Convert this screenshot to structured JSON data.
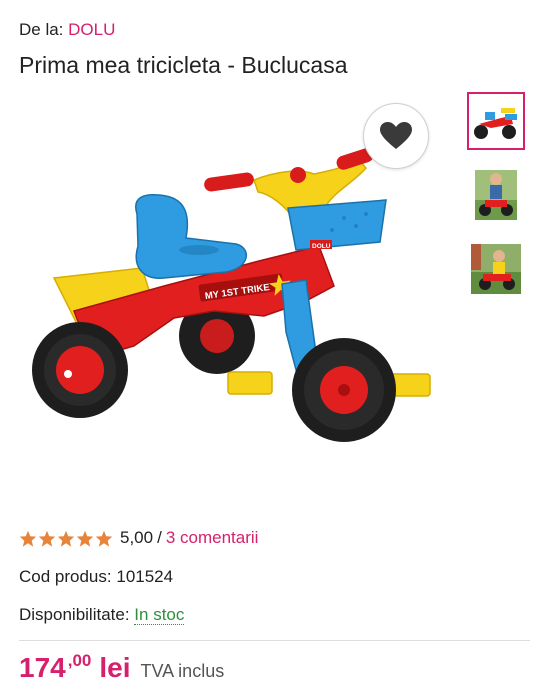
{
  "seller": {
    "prefix": "De la:",
    "name": "DOLU"
  },
  "product": {
    "title": "Prima mea tricicleta - Buclucasa",
    "decal_text": "MY 1ST TRIKE",
    "brand_badge": "DOLU"
  },
  "favorite": {
    "icon": "heart-icon"
  },
  "thumbnails": [
    {
      "name": "thumb-tricycle",
      "active": true
    },
    {
      "name": "thumb-child-riding-1",
      "active": false
    },
    {
      "name": "thumb-child-riding-2",
      "active": false
    }
  ],
  "rating": {
    "value": 5,
    "display": "5,00",
    "separator": "/",
    "reviews_label": "3 comentarii",
    "star_color": "#e8833a"
  },
  "code": {
    "label": "Cod produs:",
    "value": "101524"
  },
  "availability": {
    "label": "Disponibilitate:",
    "value": "In stoc"
  },
  "price": {
    "integer": "174",
    "decimals": ",00",
    "currency": "lei",
    "vat_note": "TVA inclus"
  },
  "colors": {
    "accent": "#d6206e",
    "in_stock": "#2f8f3a"
  }
}
